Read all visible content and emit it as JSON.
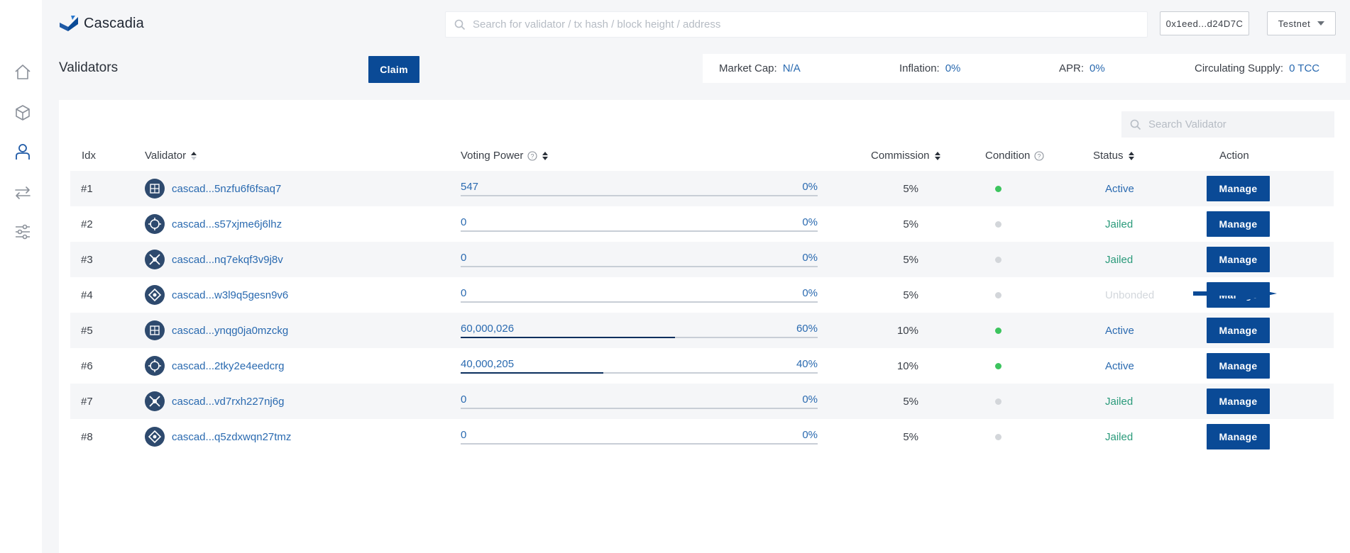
{
  "app": {
    "name": "Cascadia"
  },
  "header": {
    "search_placeholder": "Search for validator / tx hash / block height / address",
    "address": "0x1eed...d24D7C",
    "network": "Testnet"
  },
  "sidebar": {
    "items": [
      {
        "icon": "home-icon"
      },
      {
        "icon": "cube-icon"
      },
      {
        "icon": "user-icon",
        "active": true
      },
      {
        "icon": "transfer-icon"
      },
      {
        "icon": "sliders-icon"
      }
    ]
  },
  "page": {
    "title": "Validators",
    "claim_label": "Claim"
  },
  "stats": {
    "market_cap_label": "Market Cap:",
    "market_cap_value": "N/A",
    "inflation_label": "Inflation:",
    "inflation_value": "0%",
    "apr_label": "APR:",
    "apr_value": "0%",
    "supply_label": "Circulating Supply:",
    "supply_value": "0 TCC"
  },
  "table": {
    "search_placeholder": "Search Validator",
    "columns": {
      "idx": "Idx",
      "validator": "Validator",
      "voting_power": "Voting Power",
      "commission": "Commission",
      "condition": "Condition",
      "status": "Status",
      "action": "Action"
    },
    "manage_label": "Manage",
    "rows": [
      {
        "idx": "#1",
        "name": "cascad...5nzfu6f6fsaq7",
        "power": "547",
        "pct": "0%",
        "fill": 0.0,
        "commission": "5%",
        "condition": "green",
        "status": "Active",
        "status_color": "#2a6ab0"
      },
      {
        "idx": "#2",
        "name": "cascad...s57xjme6j6lhz",
        "power": "0",
        "pct": "0%",
        "fill": 0.0,
        "commission": "5%",
        "condition": "grey",
        "status": "Jailed",
        "status_color": "#2a9a7a"
      },
      {
        "idx": "#3",
        "name": "cascad...nq7ekqf3v9j8v",
        "power": "0",
        "pct": "0%",
        "fill": 0.0,
        "commission": "5%",
        "condition": "grey",
        "status": "Jailed",
        "status_color": "#2a9a7a"
      },
      {
        "idx": "#4",
        "name": "cascad...w3l9q5gesn9v6",
        "power": "0",
        "pct": "0%",
        "fill": 0.0,
        "commission": "5%",
        "condition": "grey",
        "status": "Unbonded",
        "status_color": "#d3d7dc"
      },
      {
        "idx": "#5",
        "name": "cascad...ynqg0ja0mzckg",
        "power": "60,000,026",
        "pct": "60%",
        "fill": 0.6,
        "commission": "10%",
        "condition": "green",
        "status": "Active",
        "status_color": "#2a6ab0"
      },
      {
        "idx": "#6",
        "name": "cascad...2tky2e4eedcrg",
        "power": "40,000,205",
        "pct": "40%",
        "fill": 0.4,
        "commission": "10%",
        "condition": "green",
        "status": "Active",
        "status_color": "#2a6ab0"
      },
      {
        "idx": "#7",
        "name": "cascad...vd7rxh227nj6g",
        "power": "0",
        "pct": "0%",
        "fill": 0.0,
        "commission": "5%",
        "condition": "grey",
        "status": "Jailed",
        "status_color": "#2a9a7a"
      },
      {
        "idx": "#8",
        "name": "cascad...q5zdxwqn27tmz",
        "power": "0",
        "pct": "0%",
        "fill": 0.0,
        "commission": "5%",
        "condition": "grey",
        "status": "Jailed",
        "status_color": "#2a9a7a"
      }
    ]
  },
  "colors": {
    "primary": "#0a4a96",
    "link": "#2a6ab0",
    "green_dot": "#3cc45e",
    "grey_dot": "#d3d6da"
  }
}
